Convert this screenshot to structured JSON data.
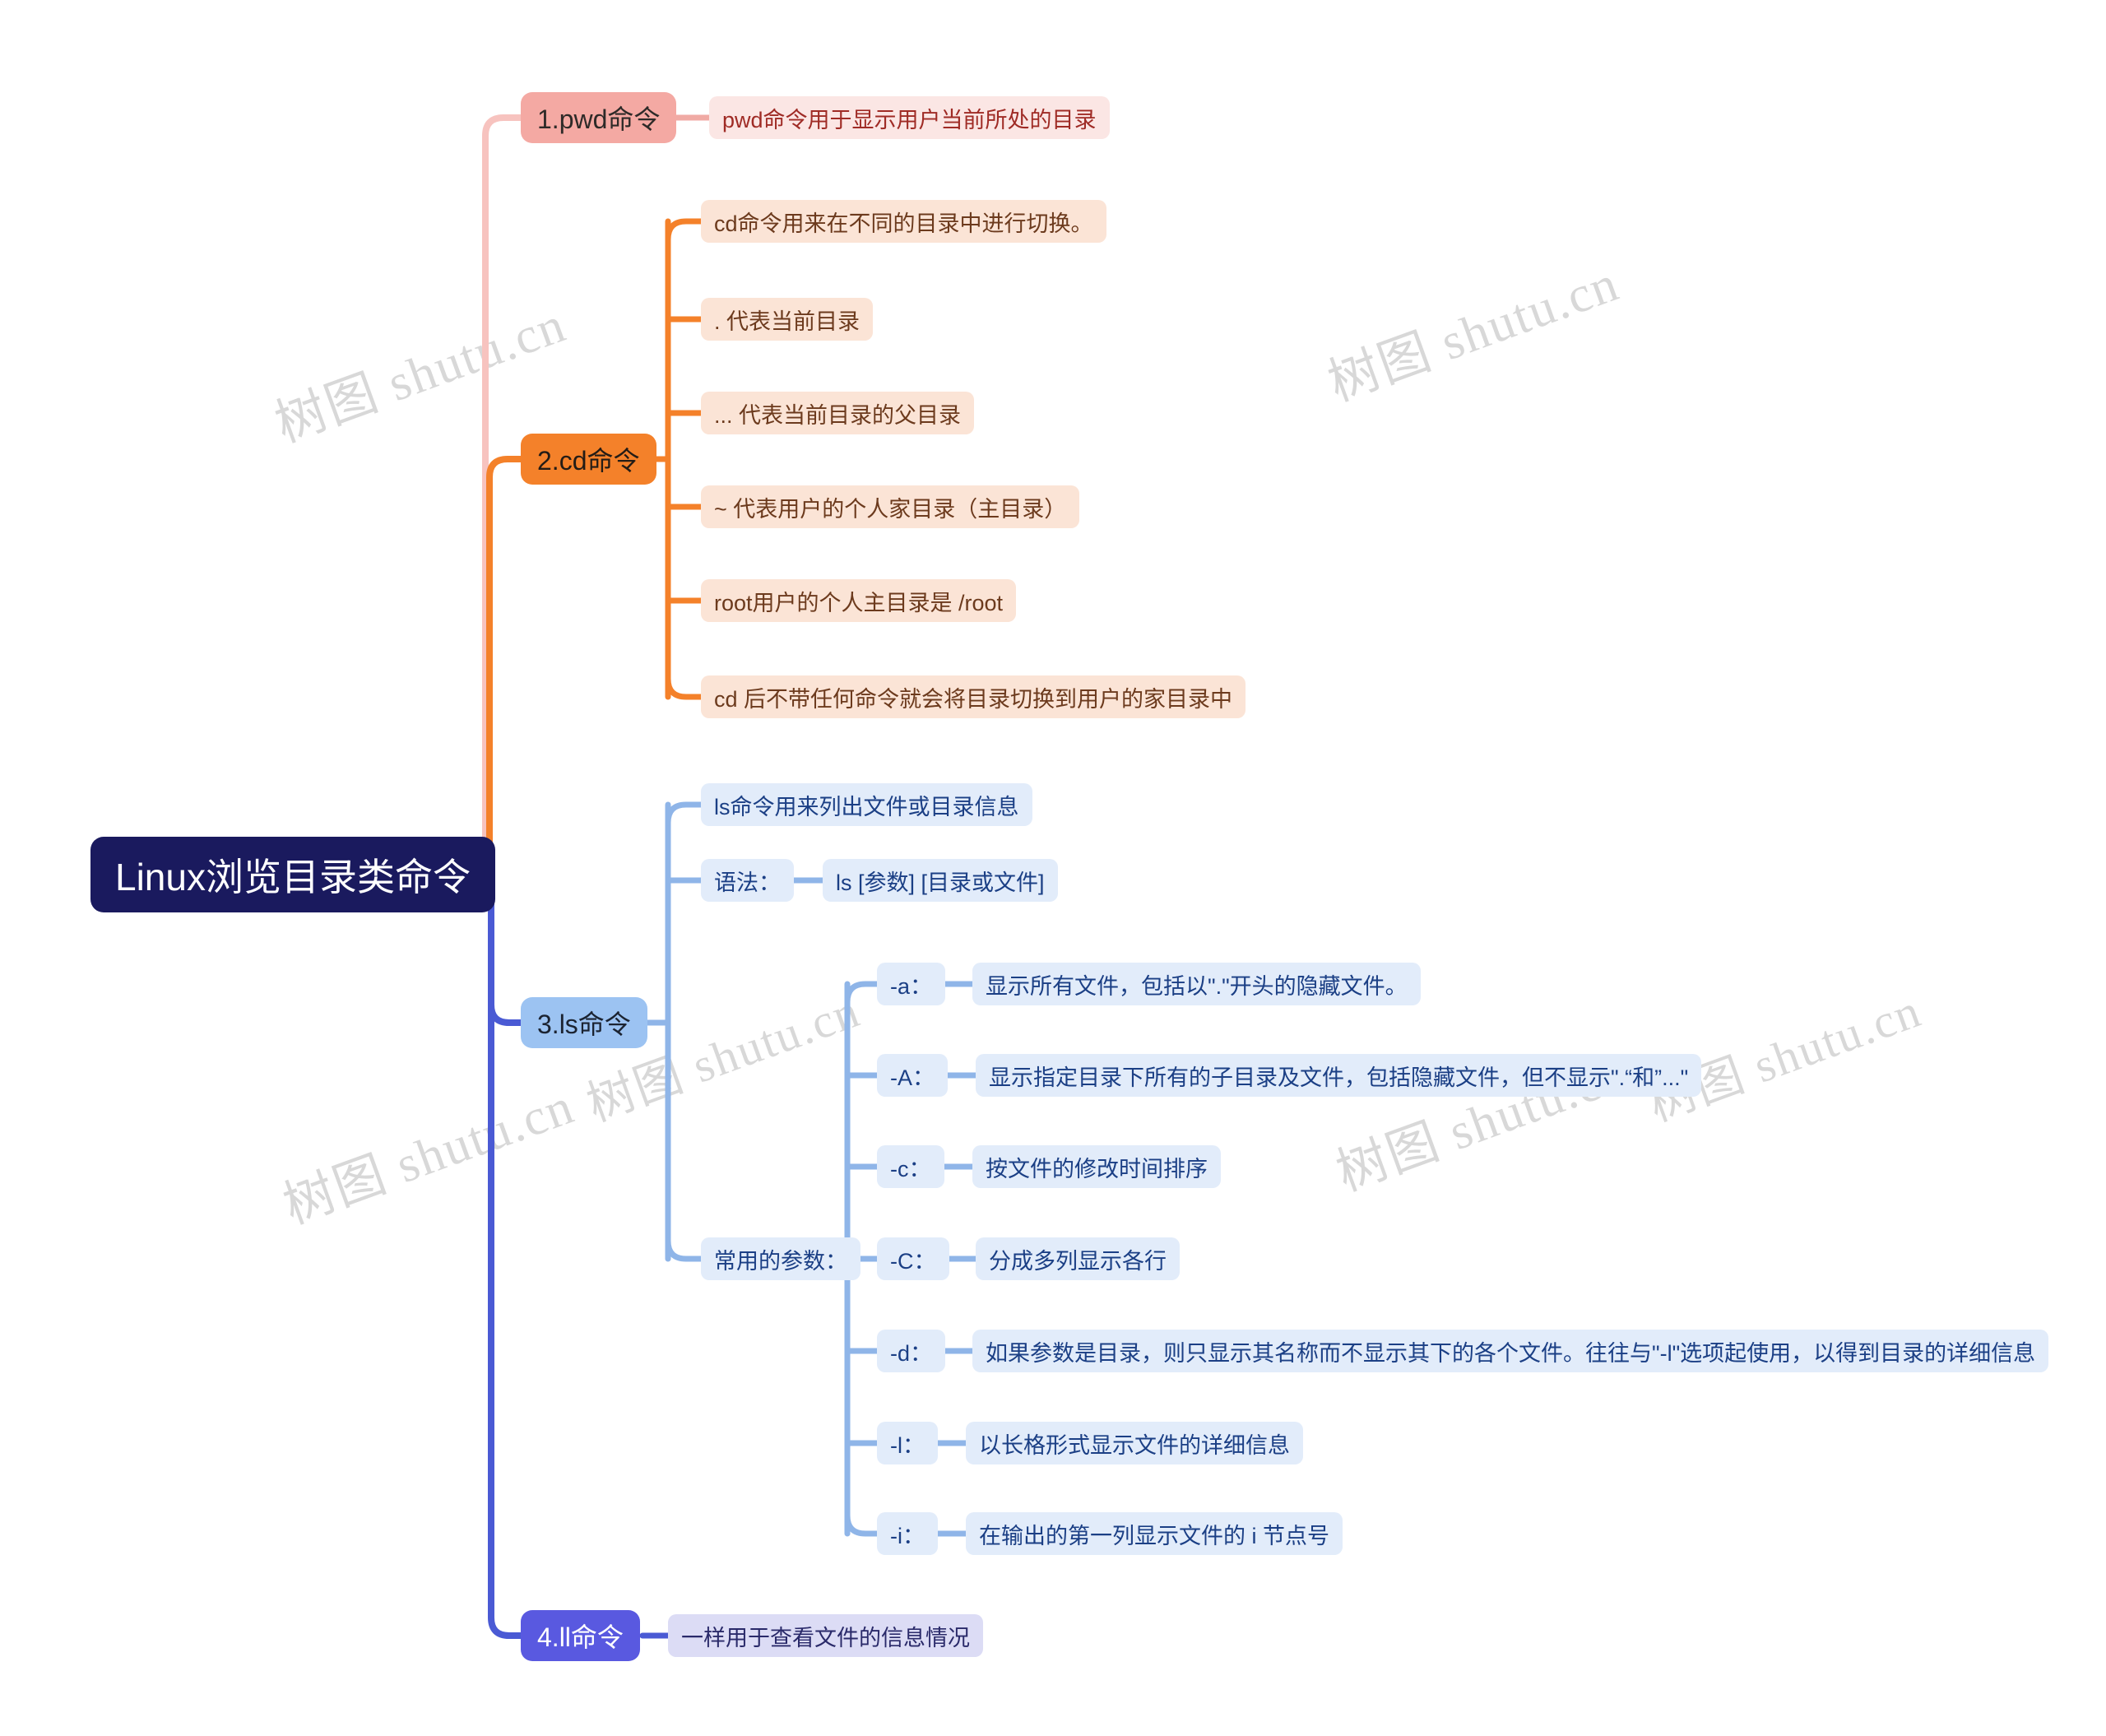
{
  "watermark": {
    "text": "树图 shutu.cn",
    "color": "#d8d8d8"
  },
  "colors": {
    "root_bg": "#1a1a5e",
    "pwd": "#f4a9a3",
    "cd": "#f4812a",
    "ls": "#9cc3f2",
    "ll": "#5959e0",
    "leaf_pink": "#fbe6e4",
    "leaf_peach": "#fbe4d6",
    "leaf_blue": "#e2ecfa"
  },
  "mindmap": {
    "root": {
      "label": "Linux浏览目录类命令"
    },
    "branches": [
      {
        "id": "pwd",
        "label": "1.pwd命令",
        "children": [
          {
            "label": "pwd命令用于显示用户当前所处的目录"
          }
        ]
      },
      {
        "id": "cd",
        "label": "2.cd命令",
        "children": [
          {
            "label": "cd命令用来在不同的目录中进行切换。"
          },
          {
            "label": ". 代表当前目录"
          },
          {
            "label": "... 代表当前目录的父目录"
          },
          {
            "label": "~ 代表用户的个人家目录（主目录）"
          },
          {
            "label": "root用户的个人主目录是 /root"
          },
          {
            "label": "cd 后不带任何命令就会将目录切换到用户的家目录中"
          }
        ]
      },
      {
        "id": "ls",
        "label": "3.ls命令",
        "children": [
          {
            "label": "ls命令用来列出文件或目录信息"
          },
          {
            "label": "语法：",
            "children": [
              {
                "label": "ls [参数] [目录或文件]"
              }
            ]
          },
          {
            "label": "常用的参数：",
            "children": [
              {
                "label": "-a：",
                "desc": "显示所有文件，包括以\".\"开头的隐藏文件。"
              },
              {
                "label": "-A：",
                "desc": "显示指定目录下所有的子目录及文件，包括隐藏文件，但不显示\".“和”...\""
              },
              {
                "label": "-c：",
                "desc": "按文件的修改时间排序"
              },
              {
                "label": "-C：",
                "desc": "分成多列显示各行"
              },
              {
                "label": "-d：",
                "desc": "如果参数是目录，则只显示其名称而不显示其下的各个文件。往往与\"-l\"选项起使用，以得到目录的详细信息"
              },
              {
                "label": "-l：",
                "desc": "以长格形式显示文件的详细信息"
              },
              {
                "label": "-i：",
                "desc": "在输出的第一列显示文件的 i 节点号"
              }
            ]
          }
        ]
      },
      {
        "id": "ll",
        "label": "4.ll命令",
        "children": [
          {
            "label": "一样用于查看文件的信息情况"
          }
        ]
      }
    ]
  }
}
